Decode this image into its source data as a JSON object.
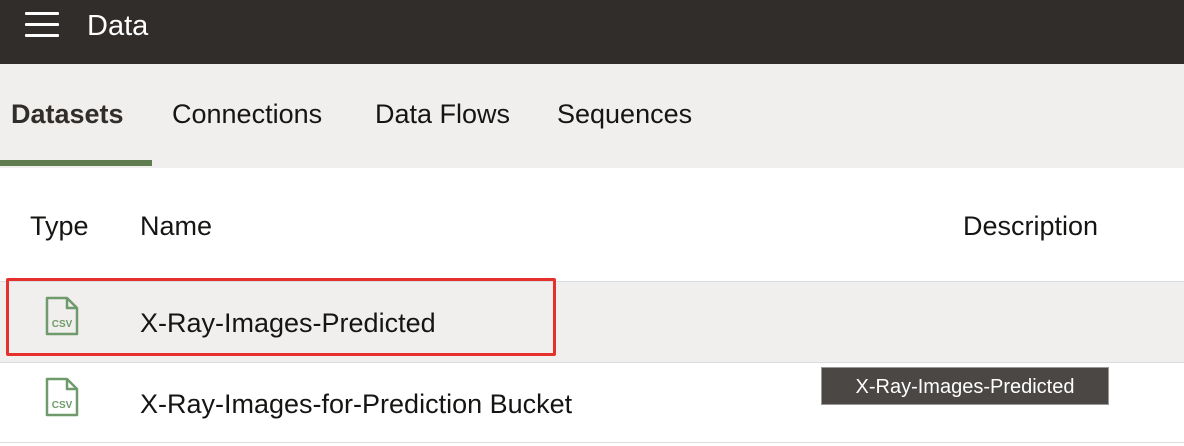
{
  "header": {
    "title": "Data",
    "menu_icon": "hamburger-menu-icon",
    "background": "#312d2a"
  },
  "tabs": [
    {
      "label": "Datasets",
      "active": true
    },
    {
      "label": "Connections",
      "active": false
    },
    {
      "label": "Data Flows",
      "active": false
    },
    {
      "label": "Sequences",
      "active": false
    }
  ],
  "table": {
    "columns": [
      "Type",
      "Name",
      "Description"
    ],
    "rows": [
      {
        "type_icon": "csv-file-icon",
        "type_text": "CSV",
        "name": "X-Ray-Images-Predicted",
        "description": "",
        "selected": true
      },
      {
        "type_icon": "csv-file-icon",
        "type_text": "CSV",
        "name": "X-Ray-Images-for-Prediction Bucket",
        "description": "",
        "selected": false
      }
    ]
  },
  "tooltip": {
    "text": "X-Ray-Images-Predicted"
  },
  "colors": {
    "accent_green": "#5f7d4f",
    "highlight_red": "#e6302b",
    "tabbar_bg": "#f1efed"
  }
}
